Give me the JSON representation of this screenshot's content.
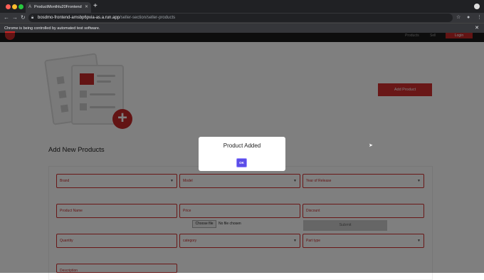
{
  "browser": {
    "tab_title": "ProductMonthlu20Frontend",
    "tab_favicon": "A",
    "new_tab": "+",
    "url_host": "bosdmo-frontend-amsbp6pvia-as.a.run.app",
    "url_path": "/seller-section/seller-products",
    "info_message": "Chrome is being controlled by automated test software."
  },
  "header": {
    "links": [
      "Products",
      "Sell",
      "Login"
    ]
  },
  "main": {
    "add_product_label": "Add Product",
    "section_title": "Add New Products",
    "fields": {
      "brand": "Brand",
      "model": "Model",
      "year": "Year of Release",
      "product_name": "Product Name",
      "price": "Price",
      "discount": "Discount",
      "quantity": "Quantity",
      "category": "category",
      "part_type": "Part type",
      "description": "Description"
    },
    "file_button": "Choose file",
    "file_status": "No file chosen",
    "submit_label": "Submit"
  },
  "modal": {
    "message": "Product Added",
    "ok_label": "OK"
  },
  "colors": {
    "accent_red": "#d32f2f",
    "modal_button": "#5b4de8",
    "browser_dark": "#202124"
  }
}
